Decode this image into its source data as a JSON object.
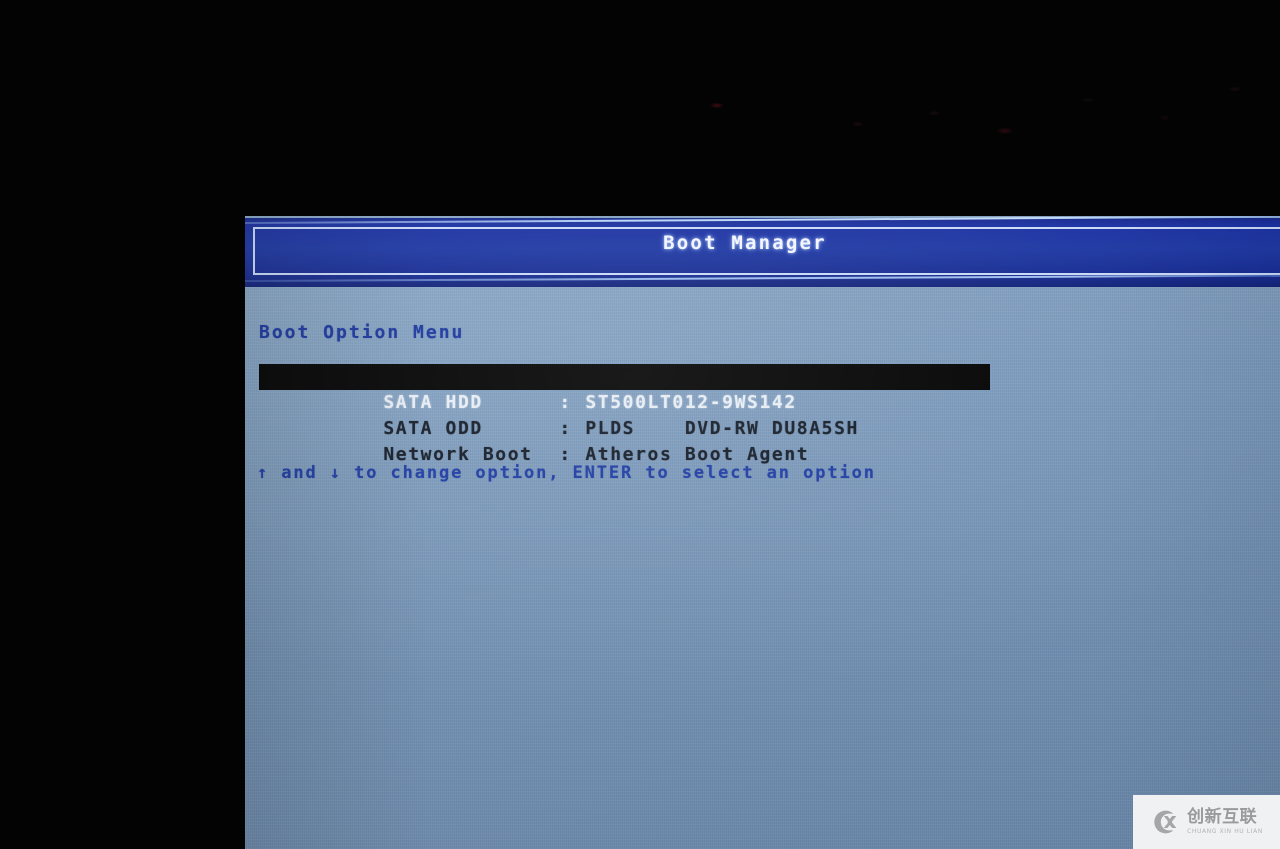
{
  "screen": {
    "title": "Boot Manager",
    "section_heading": "Boot Option Menu",
    "accent_blue": "#15309f",
    "background_blue": "#7d9bbc",
    "heading_color": "#16329c",
    "selected_bg": "#000000",
    "selected_fg": "#e8edf4"
  },
  "boot_options": [
    {
      "label": "SATA HDD",
      "sep": ":",
      "value": "ST500LT012-9WS142",
      "selected": true
    },
    {
      "label": "SATA ODD",
      "sep": ":",
      "value": "PLDS    DVD-RW DU8A5SH",
      "selected": false
    },
    {
      "label": "Network Boot",
      "sep": ":",
      "value": "Atheros Boot Agent",
      "selected": false
    }
  ],
  "hint": {
    "text": "↑ and ↓ to change option, ENTER to select an option",
    "up_arrow_icon": "arrow-up-icon",
    "down_arrow_icon": "arrow-down-icon"
  },
  "watermark": {
    "cn": "创新互联",
    "en": "CHUANG XIN HU LIAN",
    "logo_icon": "cx-logo-icon"
  }
}
